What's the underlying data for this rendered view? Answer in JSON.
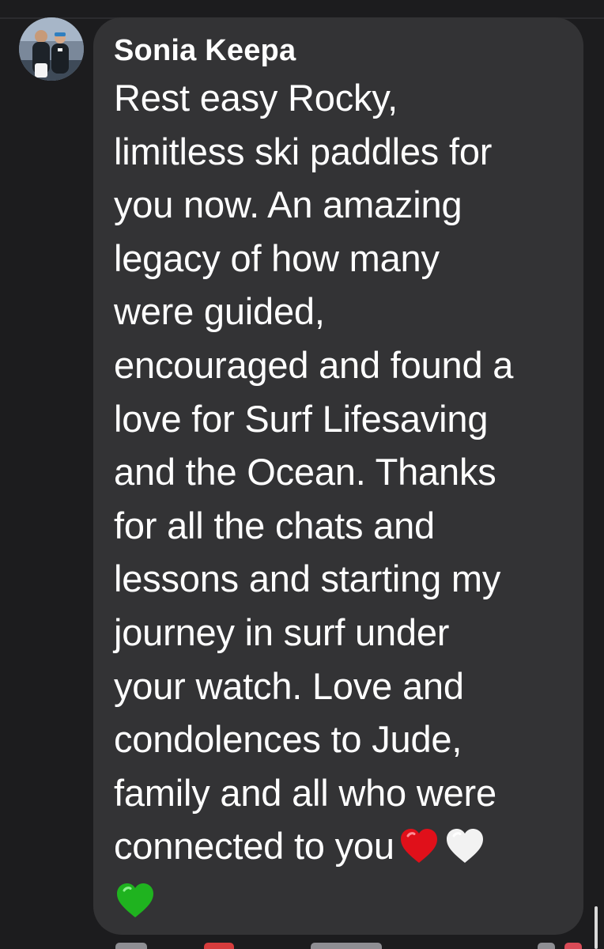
{
  "comment": {
    "author": "Sonia Keepa",
    "text_lines": "Rest easy Rocky,\nlimitless ski paddles for\nyou now. An amazing\nlegacy of how many\nwere guided,\nencouraged and found a\nlove for Surf Lifesaving\nand the Ocean. Thanks\nfor all the chats and\nlessons and starting my\njourney in surf under\nyour watch. Love and\ncondolences to Jude,\nfamily and all who were\nconnected to you",
    "emojis": [
      "red-heart",
      "white-heart",
      "green-heart"
    ]
  },
  "colors": {
    "background": "#1c1c1e",
    "bubble": "#333335",
    "text": "#ffffff",
    "red_heart": "#e0101a",
    "white_heart": "#f2f2f2",
    "green_heart": "#1fb31f"
  },
  "icons": {
    "avatar": "profile-photo",
    "emoji_1": "red-heart-icon",
    "emoji_2": "white-heart-icon",
    "emoji_3": "green-heart-icon"
  }
}
